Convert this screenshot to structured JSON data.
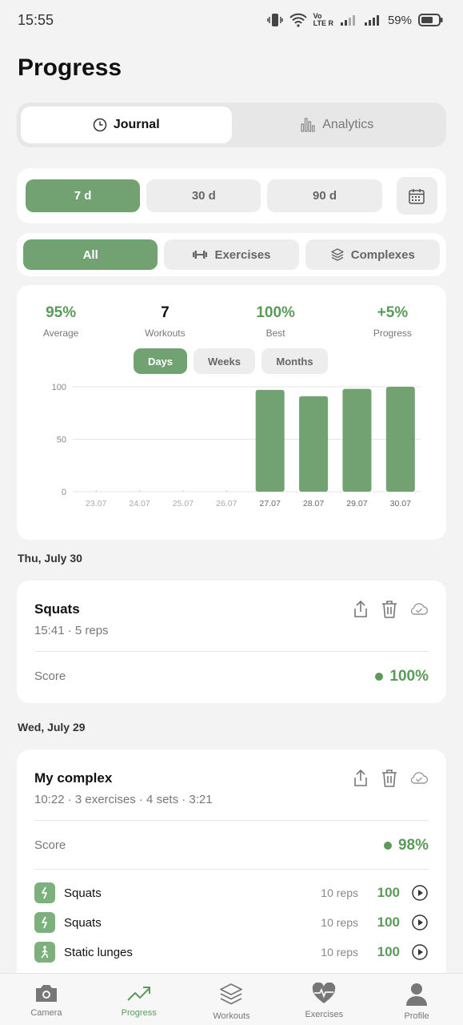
{
  "status": {
    "time": "15:55",
    "battery": "59%",
    "volte_top": "Vo",
    "volte_bottom": "LTE R"
  },
  "title": "Progress",
  "tabs": [
    {
      "label": "Journal",
      "active": true
    },
    {
      "label": "Analytics",
      "active": false
    }
  ],
  "periods": [
    {
      "label": "7 d",
      "active": true
    },
    {
      "label": "30 d",
      "active": false
    },
    {
      "label": "90 d",
      "active": false
    }
  ],
  "filters": [
    {
      "label": "All",
      "active": true
    },
    {
      "label": "Exercises",
      "active": false
    },
    {
      "label": "Complexes",
      "active": false
    }
  ],
  "stats": [
    {
      "value": "95%",
      "label": "Average"
    },
    {
      "value": "7",
      "label": "Workouts"
    },
    {
      "value": "100%",
      "label": "Best"
    },
    {
      "value": "+5%",
      "label": "Progress"
    }
  ],
  "granularity": [
    {
      "label": "Days",
      "active": true
    },
    {
      "label": "Weeks",
      "active": false
    },
    {
      "label": "Months",
      "active": false
    }
  ],
  "chart_data": {
    "type": "bar",
    "categories": [
      "23.07",
      "24.07",
      "25.07",
      "26.07",
      "27.07",
      "28.07",
      "29.07",
      "30.07"
    ],
    "values": [
      0,
      0,
      0,
      0,
      97,
      91,
      98,
      100
    ],
    "yticks": [
      "0",
      "50",
      "100"
    ],
    "ylim": [
      0,
      100
    ],
    "grid": true,
    "color": "#72a272"
  },
  "sections": [
    {
      "date": "Thu, July 30",
      "entry": {
        "title": "Squats",
        "subtitle": "15:41 · 5 reps",
        "score_label": "Score",
        "score": "100%"
      }
    },
    {
      "date": "Wed, July 29",
      "entry": {
        "title": "My complex",
        "subtitle": "10:22 · 3 exercises · 4 sets · 3:21",
        "score_label": "Score",
        "score": "98%",
        "exercises": [
          {
            "name": "Squats",
            "reps": "10 reps",
            "score": "100"
          },
          {
            "name": "Squats",
            "reps": "10 reps",
            "score": "100"
          },
          {
            "name": "Static lunges",
            "reps": "10 reps",
            "score": "100"
          }
        ]
      }
    }
  ],
  "nav": [
    {
      "label": "Camera",
      "icon": "camera-icon",
      "active": false
    },
    {
      "label": "Progress",
      "icon": "trend-icon",
      "active": true
    },
    {
      "label": "Workouts",
      "icon": "layers-icon",
      "active": false
    },
    {
      "label": "Exercises",
      "icon": "heart-pulse-icon",
      "active": false
    },
    {
      "label": "Profile",
      "icon": "person-icon",
      "active": false
    }
  ],
  "colors": {
    "accent": "#72a272",
    "accent_text": "#5a9a5a",
    "background": "#f3f3f3"
  }
}
